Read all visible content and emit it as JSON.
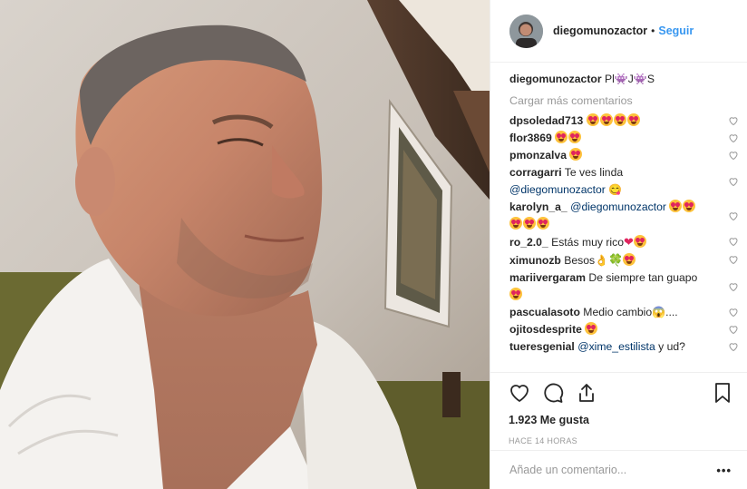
{
  "header": {
    "username": "diegomunozactor",
    "separator": "•",
    "follow_label": "Seguir"
  },
  "caption": {
    "username": "diegomunozactor",
    "text_a": "Pl",
    "text_b": "J",
    "text_c": "S",
    "glyph_icon": "alien-monster-icon"
  },
  "load_more_label": "Cargar más comentarios",
  "comments": [
    {
      "username": "dpsoledad713",
      "text": ""
    },
    {
      "username": "flor3869",
      "text": ""
    },
    {
      "username": "pmonzalva",
      "text": ""
    },
    {
      "username": "corragarri",
      "text": "Te ves linda",
      "mention": "@diegomunozactor"
    },
    {
      "username": "karolyn_a_",
      "mention": "@diegomunozactor"
    },
    {
      "username": "ro_2.0_",
      "text": "Estás muy rico"
    },
    {
      "username": "ximunozb",
      "text": "Besos"
    },
    {
      "username": "mariivergaram",
      "text": "De siempre tan guapo"
    },
    {
      "username": "pascualasoto",
      "text": "Medio cambio",
      "suffix": "...."
    },
    {
      "username": "ojitosdesprite",
      "text": ""
    },
    {
      "username": "tueresgenial",
      "mention": "@xime_estilista",
      "text": "y ud?"
    }
  ],
  "likes_count": "1.923",
  "likes_label": "Me gusta",
  "timestamp": "HACE 14 HORAS",
  "add_comment": {
    "placeholder": "Añade un comentario...",
    "more_label": "•••"
  },
  "colors": {
    "link": "#3897f0",
    "mention": "#003569",
    "muted": "#999999",
    "text": "#262626"
  }
}
